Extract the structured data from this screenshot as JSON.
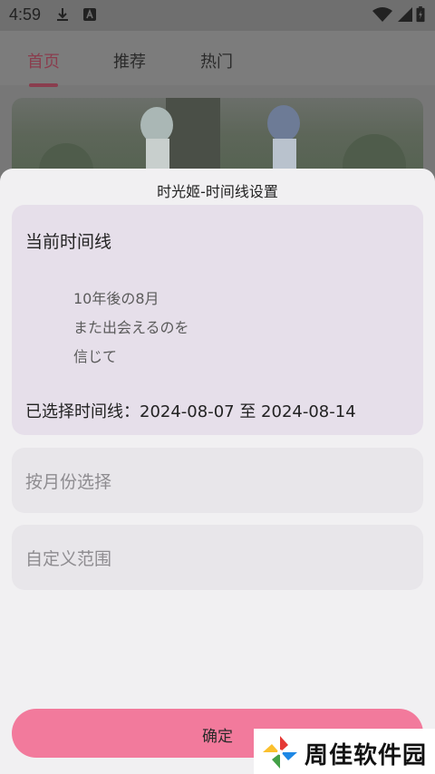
{
  "status_bar": {
    "time": "4:59"
  },
  "tabs": [
    {
      "label": "首页"
    },
    {
      "label": "推荐"
    },
    {
      "label": "热门"
    }
  ],
  "sheet": {
    "title": "时光姬-时间线设置",
    "current": {
      "heading": "当前时间线",
      "quote_lines": [
        "10年後の8月",
        "また出会えるのを",
        "信じて"
      ],
      "selected_range": "已选择时间线：2024-08-07 至 2024-08-14"
    },
    "options": [
      {
        "label": "按月份选择"
      },
      {
        "label": "自定义范围"
      }
    ],
    "confirm_label": "确定"
  },
  "watermark": {
    "text": "周佳软件园"
  },
  "colors": {
    "accent": "#f27a9c",
    "card_highlight": "#e6dfea",
    "tab_active": "#8a3d4e"
  }
}
